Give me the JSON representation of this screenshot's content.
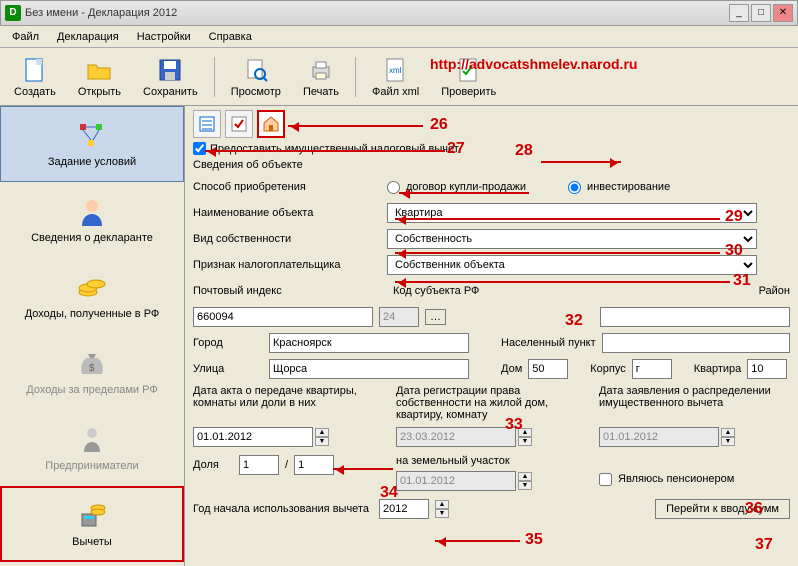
{
  "window": {
    "title": "Без имени - Декларация 2012"
  },
  "menu": {
    "file": "Файл",
    "decl": "Декларация",
    "settings": "Настройки",
    "help": "Справка"
  },
  "toolbar": {
    "create": "Создать",
    "open": "Открыть",
    "save": "Сохранить",
    "preview": "Просмотр",
    "print": "Печать",
    "xml": "Файл xml",
    "check": "Проверить"
  },
  "url": "http://advocatshmelev.narod.ru",
  "sidebar": {
    "conditions": "Задание условий",
    "declarant": "Сведения о декларанте",
    "income_rf": "Доходы, полученные в РФ",
    "income_abroad": "Доходы за пределами РФ",
    "entrepreneurs": "Предприниматели",
    "deductions": "Вычеты"
  },
  "form": {
    "chk_grant": "Предоставить имущественный налоговый вычет",
    "section": "Сведения об объекте",
    "method_label": "Способ приобретения",
    "method_contract": "договор купли-продажи",
    "method_invest": "инвестирование",
    "obj_name_label": "Наименование объекта",
    "obj_name_value": "Квартира",
    "ownership_label": "Вид собственности",
    "ownership_value": "Собственность",
    "taxpayer_label": "Признак налогоплательщика",
    "taxpayer_value": "Собственник объекта",
    "postcode_label": "Почтовый индекс",
    "postcode_value": "660094",
    "region_label": "Код субъекта РФ",
    "region_value": "24",
    "district_label": "Район",
    "city_label": "Город",
    "city_value": "Красноярск",
    "locality_label": "Населенный пункт",
    "street_label": "Улица",
    "street_value": "Щорса",
    "house_label": "Дом",
    "house_value": "50",
    "corpus_label": "Корпус",
    "corpus_value": "г",
    "apt_label": "Квартира",
    "apt_value": "10",
    "date_act_label": "Дата акта о передаче квартиры, комнаты или доли в них",
    "date_act_value": "01.01.2012",
    "date_reg_label": "Дата регистрации права собственности на жилой дом, квартиру, комнату",
    "date_reg_value": "23.03.2012",
    "date_decl_label": "Дата заявления о распределении имущественного вычета",
    "date_decl_value": "01.01.2012",
    "land_label": "на земельный участок",
    "land_value": "01.01.2012",
    "share_label": "Доля",
    "share_a": "1",
    "share_b": "1",
    "pensioner_label": "Являюсь пенсионером",
    "year_label": "Год начала использования вычета",
    "year_value": "2012",
    "goto_btn": "Перейти к вводу сумм"
  },
  "annotations": {
    "n26": "26",
    "n27": "27",
    "n28": "28",
    "n29": "29",
    "n30": "30",
    "n31": "31",
    "n32": "32",
    "n33": "33",
    "n34": "34",
    "n35": "35",
    "n36": "36",
    "n37": "37"
  }
}
